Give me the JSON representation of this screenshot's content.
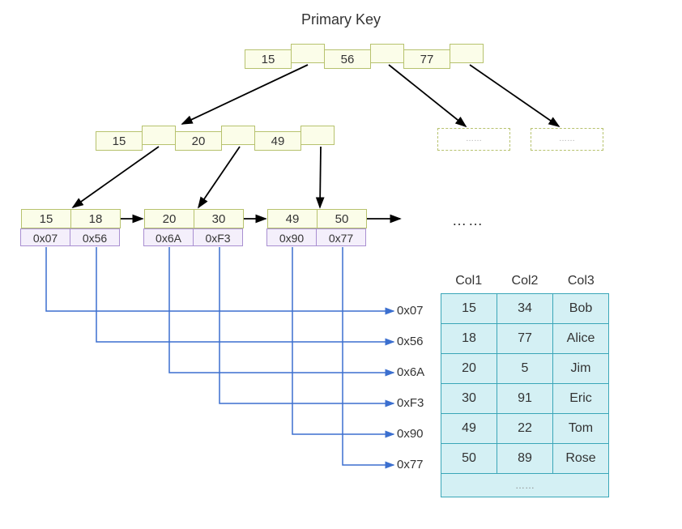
{
  "title": "Primary Key",
  "root": {
    "keys": [
      "15",
      "56",
      "77"
    ]
  },
  "internal": {
    "keys": [
      "15",
      "20",
      "49"
    ]
  },
  "leaves": [
    {
      "keys": [
        "15",
        "18"
      ],
      "ptrs": [
        "0x07",
        "0x56"
      ]
    },
    {
      "keys": [
        "20",
        "30"
      ],
      "ptrs": [
        "0x6A",
        "0xF3"
      ]
    },
    {
      "keys": [
        "49",
        "50"
      ],
      "ptrs": [
        "0x90",
        "0x77"
      ]
    }
  ],
  "ellipsis": "……",
  "row_labels": [
    "0x07",
    "0x56",
    "0x6A",
    "0xF3",
    "0x90",
    "0x77"
  ],
  "table": {
    "headers": [
      "Col1",
      "Col2",
      "Col3"
    ],
    "rows": [
      [
        "15",
        "34",
        "Bob"
      ],
      [
        "18",
        "77",
        "Alice"
      ],
      [
        "20",
        "5",
        "Jim"
      ],
      [
        "30",
        "91",
        "Eric"
      ],
      [
        "49",
        "22",
        "Tom"
      ],
      [
        "50",
        "89",
        "Rose"
      ]
    ],
    "footer": "……"
  }
}
